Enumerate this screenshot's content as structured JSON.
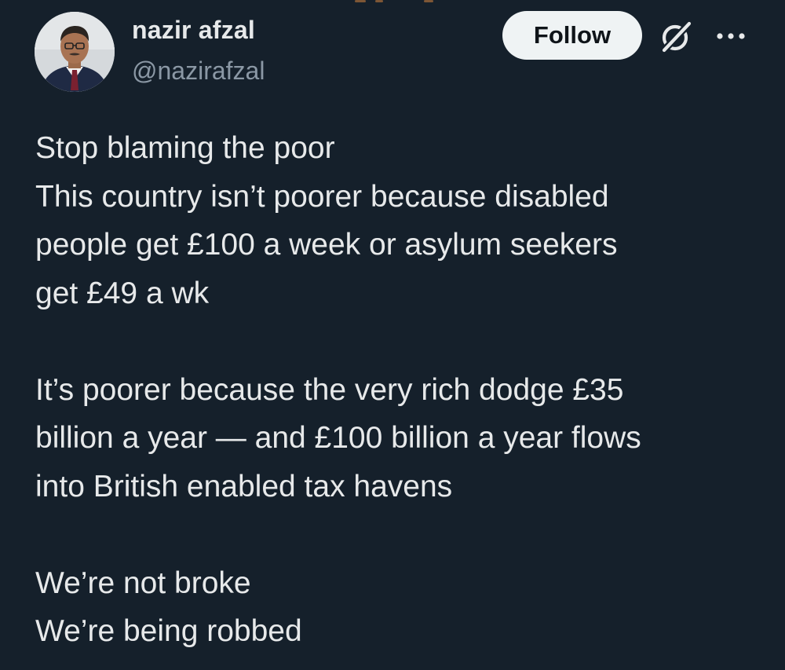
{
  "author": {
    "name": "nazir afzal",
    "handle": "@nazirafzal",
    "avatar_icon": "profile-photo"
  },
  "actions": {
    "follow_label": "Follow",
    "grok_icon": "grok-icon",
    "more_icon": "more-options-icon"
  },
  "tweet": {
    "paragraphs": [
      {
        "lines": [
          "Stop blaming the poor",
          "This country isn’t poorer because disabled",
          "people get £100 a week or asylum seekers",
          "get £49 a wk"
        ]
      },
      {
        "lines": [
          "It’s poorer because the very rich dodge £35",
          "billion a year — and £100 billion a year flows",
          "into British enabled tax havens"
        ]
      },
      {
        "lines": [
          "We’re not broke",
          "We’re being robbed"
        ]
      }
    ]
  },
  "colors": {
    "background": "#15202b",
    "text_primary": "#e7e9ea",
    "text_secondary": "#8b98a5",
    "follow_bg": "#eff3f4",
    "follow_text": "#0f1419"
  }
}
